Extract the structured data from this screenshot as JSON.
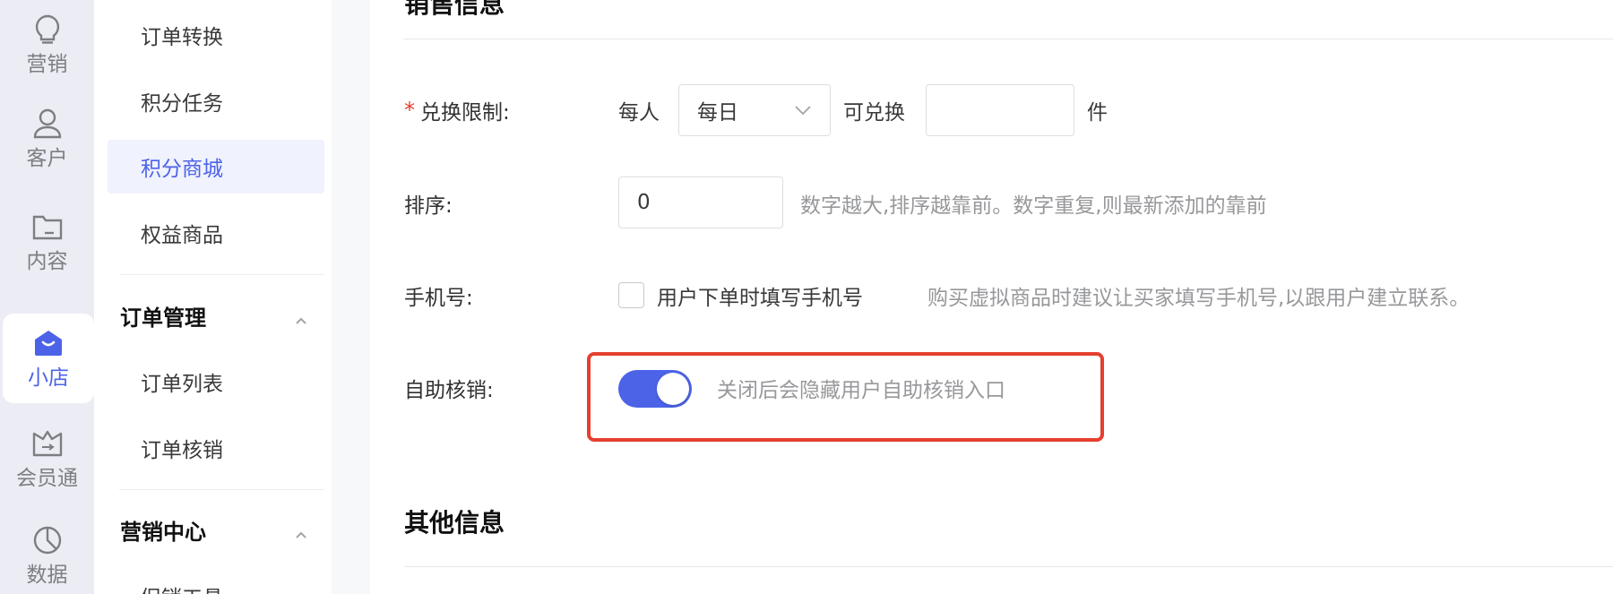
{
  "rail": {
    "items": [
      {
        "label": "营销",
        "icon": "lightbulb-icon"
      },
      {
        "label": "客户",
        "icon": "user-icon"
      },
      {
        "label": "内容",
        "icon": "folder-icon"
      },
      {
        "label": "小店",
        "icon": "shop-bag-icon"
      },
      {
        "label": "会员通",
        "icon": "crown-icon"
      },
      {
        "label": "数据",
        "icon": "pie-chart-icon"
      }
    ],
    "active_index": 3
  },
  "subnav": {
    "items_top": [
      "订单转换",
      "积分任务",
      "积分商城",
      "权益商品"
    ],
    "active": "积分商城",
    "group_orders": {
      "title": "订单管理",
      "items": [
        "订单列表",
        "订单核销"
      ]
    },
    "group_marketing": {
      "title": "营销中心",
      "items": [
        "促销工具"
      ]
    }
  },
  "main": {
    "top_section_title": "销售信息",
    "exchange_limit": {
      "label": "兑换限制:",
      "required_mark": "*",
      "prefix": "每人",
      "period_value": "每日",
      "middle": "可兑换",
      "quantity_value": "",
      "unit": "件"
    },
    "sort": {
      "label": "排序:",
      "value": "0",
      "hint": "数字越大,排序越靠前。数字重复,则最新添加的靠前"
    },
    "phone": {
      "label": "手机号:",
      "checkbox_label": "用户下单时填写手机号",
      "checked": false,
      "hint": "购买虚拟商品时建议让买家填写手机号,以跟用户建立联系。"
    },
    "self_verify": {
      "label": "自助核销:",
      "enabled": true,
      "hint": "关闭后会隐藏用户自助核销入口"
    },
    "other_section_title": "其他信息"
  },
  "colors": {
    "accent": "#4c63e8",
    "required": "#e5402f",
    "highlight_border": "#e5402f"
  }
}
